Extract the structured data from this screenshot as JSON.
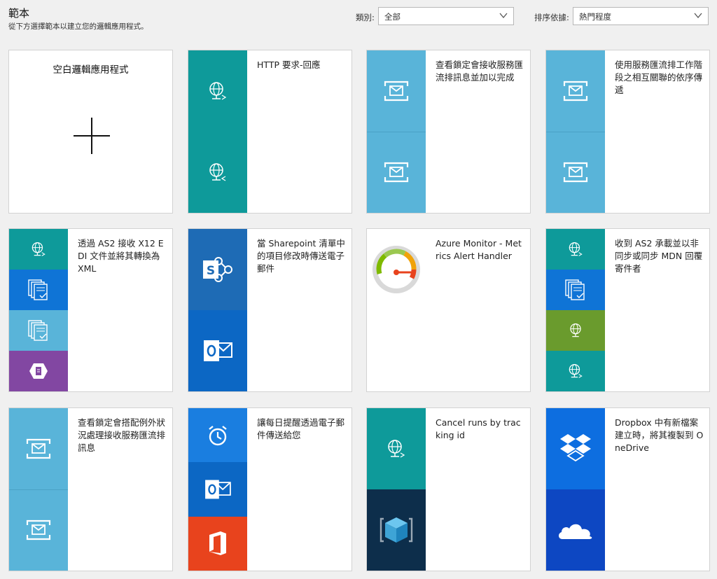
{
  "header": {
    "title": "範本",
    "subtitle": "從下方選擇範本以建立您的邏輯應用程式。"
  },
  "filters": {
    "category_label": "類別:",
    "category_value": "全部",
    "sort_label": "排序依據:",
    "sort_value": "熱門程度"
  },
  "colors": {
    "teal": "#0e9a9a",
    "light_blue": "#59b4d9",
    "blue": "#0f74d6",
    "sharepoint_blue": "#1e6bb5",
    "outlook_blue": "#0c67c4",
    "purple": "#8247a2",
    "olive": "#6a9b2d",
    "office_red": "#e8431d",
    "dark_navy": "#0d2e4b",
    "dropbox_blue": "#0d6ee0"
  },
  "templates": [
    {
      "title": "空白邏輯應用程式",
      "icons": [
        "plus-icon"
      ]
    },
    {
      "title": "HTTP 要求-回應",
      "icons": [
        "http-globe-icon",
        "http-globe-response-icon"
      ]
    },
    {
      "title": "查看鎖定會接收服務匯流排訊息並加以完成",
      "icons": [
        "service-bus-icon",
        "service-bus-icon"
      ]
    },
    {
      "title": "使用服務匯流排工作階段之相互關聯的依序傳遞",
      "icons": [
        "service-bus-icon",
        "service-bus-icon"
      ]
    },
    {
      "title": "透過 AS2 接收 X12 EDI 文件並將其轉換為 XML",
      "icons": [
        "http-globe-icon",
        "documents-icon",
        "documents-icon",
        "transform-icon"
      ]
    },
    {
      "title": "當 Sharepoint 清單中的項目修改時傳送電子郵件",
      "icons": [
        "sharepoint-icon",
        "outlook-icon"
      ]
    },
    {
      "title": "Azure Monitor - Metrics Alert Handler",
      "icons": [
        "gauge-icon"
      ]
    },
    {
      "title": "收到 AS2 承載並以非同步或同步 MDN 回覆寄件者",
      "icons": [
        "http-globe-icon",
        "documents-icon",
        "globe-icon",
        "http-globe-icon"
      ]
    },
    {
      "title": "查看鎖定會搭配例外狀況處理接收服務匯流排訊息",
      "icons": [
        "service-bus-icon",
        "service-bus-icon"
      ]
    },
    {
      "title": "讓每日提醒透過電子郵件傳送給您",
      "icons": [
        "alarm-clock-icon",
        "outlook-icon",
        "office-icon"
      ]
    },
    {
      "title": "Cancel runs by tracking id",
      "icons": [
        "http-globe-icon",
        "cube-icon"
      ]
    },
    {
      "title": "Dropbox 中有新檔案建立時，將其複製到 OneDrive",
      "icons": [
        "dropbox-icon",
        "onedrive-icon"
      ]
    }
  ]
}
